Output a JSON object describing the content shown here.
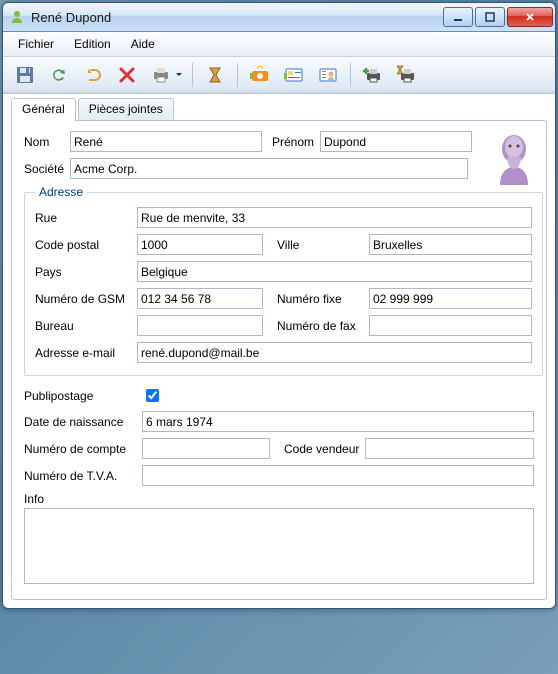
{
  "window": {
    "title": "René Dupond"
  },
  "menu": {
    "file": "Fichier",
    "edit": "Edition",
    "help": "Aide"
  },
  "toolbar": {
    "save": "save",
    "refresh": "refresh",
    "undo": "undo",
    "delete": "delete",
    "print": "print",
    "timer": "timer",
    "camera": "camera",
    "id": "id",
    "portrait": "portrait",
    "addprinter": "addprinter",
    "timerprinter": "timerprinter"
  },
  "tabs": {
    "general": "Général",
    "attachments": "Pièces jointes"
  },
  "labels": {
    "nom": "Nom",
    "prenom": "Prénom",
    "societe": "Société",
    "adresse": "Adresse",
    "rue": "Rue",
    "cp": "Code postal",
    "ville": "Ville",
    "pays": "Pays",
    "gsm": "Numéro de GSM",
    "fixe": "Numéro fixe",
    "bureau": "Bureau",
    "fax": "Numéro de fax",
    "email": "Adresse e-mail",
    "publi": "Publipostage",
    "dob": "Date de naissance",
    "compte": "Numéro de compte",
    "vendeur": "Code vendeur",
    "tva": "Numéro de T.V.A.",
    "info": "Info"
  },
  "values": {
    "nom": "René",
    "prenom": "Dupond",
    "societe": "Acme Corp.",
    "rue": "Rue de menvite, 33",
    "cp": "1000",
    "ville": "Bruxelles",
    "pays": "Belgique",
    "gsm": "012 34 56 78",
    "fixe": "02 999 999",
    "bureau": "",
    "fax": "",
    "email": "rené.dupond@mail.be",
    "publi": true,
    "dob": "6 mars 1974",
    "compte": "",
    "vendeur": "",
    "tva": "",
    "info": ""
  }
}
